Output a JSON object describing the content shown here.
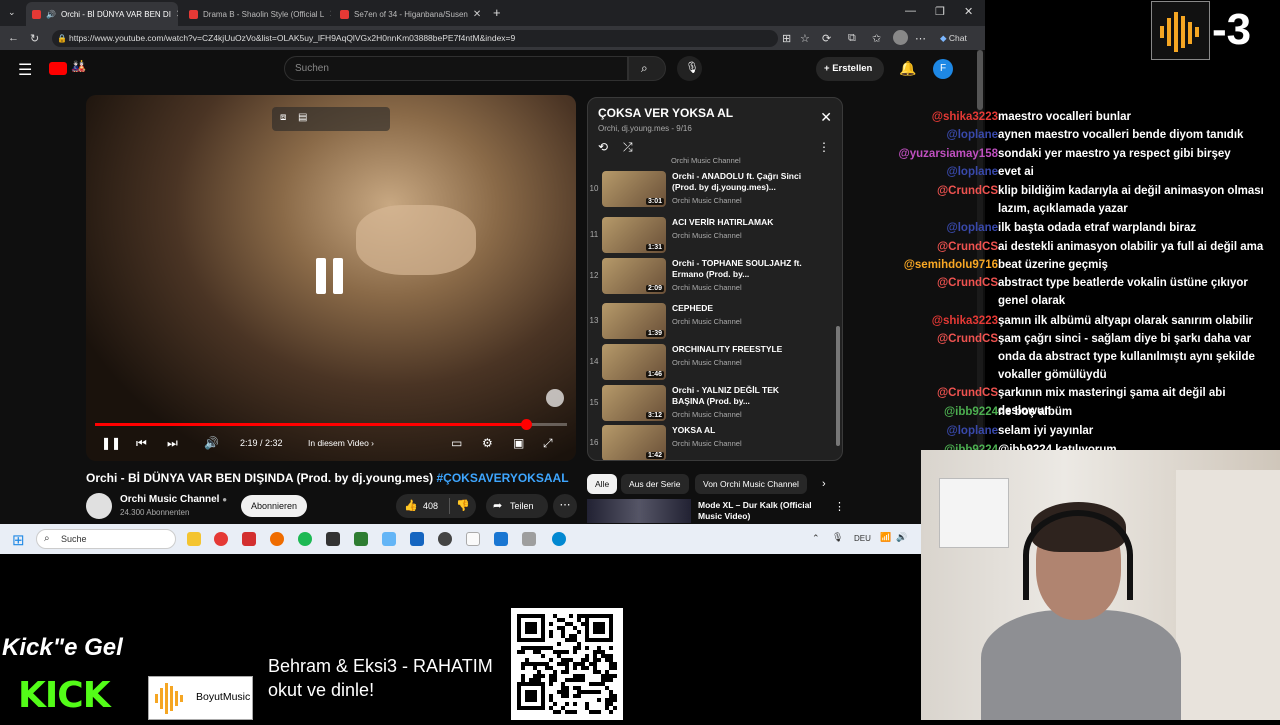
{
  "browser": {
    "tabs": [
      {
        "label": "Orchi - Bİ DÜNYA VAR BEN DI",
        "active": true
      },
      {
        "label": "Drama B - Shaolin Style (Official L",
        "active": false
      },
      {
        "label": "Se7en of 34 - Higanbana/Susen",
        "active": false
      }
    ],
    "url": "https://www.youtube.com/watch?v=CZ4kjUuOzVo&list=OLAK5uy_lFH9AqQlVGx2H0nnKm03888bePE7f4ntM&index=9",
    "chat_label": "Chat"
  },
  "youtube": {
    "search_placeholder": "Suchen",
    "create_label": "Erstellen",
    "avatar_letter": "F",
    "player": {
      "time": "2:19 / 2:32",
      "chapter_label": "In diesem Video",
      "progress": 0.914
    },
    "video": {
      "title": "Orchi - Bİ DÜNYA VAR BEN DIŞINDA (Prod. by dj.young.mes)",
      "hashtag": "#ÇOKSAVERYOKSAAL",
      "channel": "Orchi Music Channel",
      "subscribers": "24.300 Abonnenten",
      "subscribe_label": "Abonnieren",
      "likes": "408",
      "share_label": "Teilen"
    },
    "playlist": {
      "title": "ÇOKSA VER YOKSA AL",
      "subtitle": "Orchi, dj.young.mes - 9/16",
      "partial_channel": "Orchi Music Channel",
      "items": [
        {
          "num": "10",
          "title": "Orchi - ANADOLU ft. Çağrı Sinci (Prod. by dj.young.mes)...",
          "channel": "Orchi Music Channel",
          "duration": "3:01"
        },
        {
          "num": "11",
          "title": "ACI VERİR HATIRLAMAK",
          "channel": "Orchi Music Channel",
          "duration": "1:31"
        },
        {
          "num": "12",
          "title": "Orchi - TOPHANE SOULJAHZ ft. Ermano (Prod. by...",
          "channel": "Orchi Music Channel",
          "duration": "2:09"
        },
        {
          "num": "13",
          "title": "CEPHEDE",
          "channel": "Orchi Music Channel",
          "duration": "1:39"
        },
        {
          "num": "14",
          "title": "ORCHINALITY FREESTYLE",
          "channel": "Orchi Music Channel",
          "duration": "1:46"
        },
        {
          "num": "15",
          "title": "Orchi - YALNIZ DEĞİL TEK BAŞINA (Prod. by...",
          "channel": "Orchi Music Channel",
          "duration": "3:12"
        },
        {
          "num": "16",
          "title": "YOKSA AL",
          "channel": "Orchi Music Channel",
          "duration": "1:42"
        }
      ]
    },
    "chips": [
      "Alle",
      "Aus der Serie",
      "Von Orchi Music Channel"
    ],
    "next_video_title": "Mode XL – Dur Kalk (Official Music Video)"
  },
  "taskbar": {
    "search_label": "Suche",
    "language": "DEU"
  },
  "chat": {
    "messages": [
      {
        "user": "@shika3223",
        "text": "maestro vocalleri bunlar",
        "color": "#e53935"
      },
      {
        "user": "@loplane",
        "text": "aynen maestro vocalleri bende diyom tanıdık",
        "color": "#3949ab"
      },
      {
        "user": "@yuzarsiamay158",
        "text": "sondaki yer maestro ya respect gibi birşey",
        "color": "#c050c0"
      },
      {
        "user": "@loplane",
        "text": "evet ai",
        "color": "#3949ab"
      },
      {
        "user": "@CrundCS",
        "text": "klip bildiğim kadarıyla ai değil animasyon olması lazım, açıklamada yazar",
        "color": "#ef5350"
      },
      {
        "user": "@loplane",
        "text": "ilk başta odada etraf warplandı biraz",
        "color": "#3949ab"
      },
      {
        "user": "@CrundCS",
        "text": "ai destekli animasyon olabilir ya full ai değil ama",
        "color": "#ef5350"
      },
      {
        "user": "@semihdolu9716",
        "text": "beat üzerine geçmiş",
        "color": "#f9a825"
      },
      {
        "user": "@CrundCS",
        "text": "abstract type beatlerde vokalin üstüne çıkıyor genel olarak",
        "color": "#ef5350"
      },
      {
        "user": "@shika3223",
        "text": "şamın ilk albümü altyapı olarak sanırım olabilir",
        "color": "#e53935"
      },
      {
        "user": "@CrundCS",
        "text": "şam çağrı sinci - sağlam diye bi şarkı daha var onda da abstract type kullanılmıştı aynı şekilde vokaller gömülüydü",
        "color": "#ef5350"
      },
      {
        "user": "@CrundCS",
        "text": "şarkının mix masteringi şama ait değil abi deslowun",
        "color": "#ef5350"
      },
      {
        "user": "@ibb9224",
        "text": "ne boş albüm",
        "color": "#4caf50"
      },
      {
        "user": "@loplane",
        "text": "selam iyi yayınlar",
        "color": "#3949ab"
      },
      {
        "user": "@ibb9224",
        "text": "@ibb9224 katılıyorum",
        "color": "#4caf50"
      }
    ]
  },
  "overlay": {
    "counter": "-3",
    "kick_tagline": "Kick\"e Gel",
    "kick_logo": "KICK",
    "boyut_label": "BoyutMusic",
    "song_line1": "Behram & Eksi3 - RAHATIM",
    "song_line2": "okut ve dinle!"
  },
  "colors": {
    "youtube_red": "#ff0000",
    "kick_green": "#53fc18",
    "link_blue": "#3ea6ff"
  }
}
